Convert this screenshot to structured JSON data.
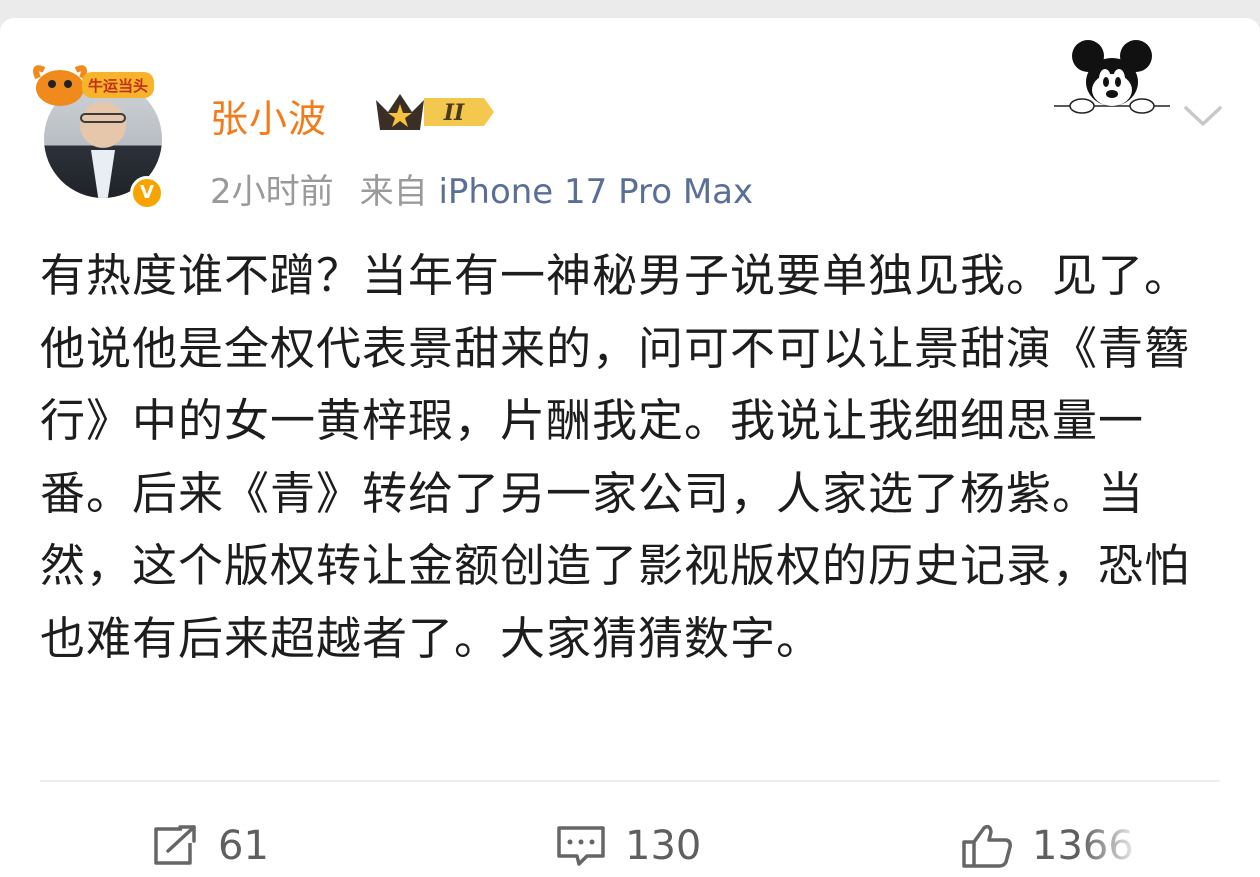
{
  "post": {
    "author": {
      "name": "张小波",
      "pendant_text": "牛运当头",
      "level_badge": "II",
      "verified_mark": "V"
    },
    "time": "2小时前",
    "source_prefix": "来自",
    "device": "iPhone 17 Pro Max",
    "text": "有热度谁不蹭？当年有一神秘男子说要单独见我。见了。他说他是全权代表景甜来的，问可不可以让景甜演《青簪行》中的女一黄梓瑕，片酬我定。我说让我细细思量一番。后来《青》转给了另一家公司，人家选了杨紫。当然，这个版权转让金额创造了影视版权的历史记录，恐怕也难有后来超越者了。大家猜猜数字。"
  },
  "actions": {
    "repost": {
      "icon": "repost-icon",
      "count": "61"
    },
    "comment": {
      "icon": "comment-icon",
      "count": "130"
    },
    "like": {
      "icon": "like-icon",
      "count": "1366"
    }
  },
  "icons": {
    "menu": "chevron-down-icon",
    "decor": "mickey-icon"
  },
  "colors": {
    "name": "#f27b1c",
    "device": "#5a6f98",
    "text": "#1d1d1d",
    "meta": "#9a9a9a",
    "verified": "#f7a400"
  }
}
